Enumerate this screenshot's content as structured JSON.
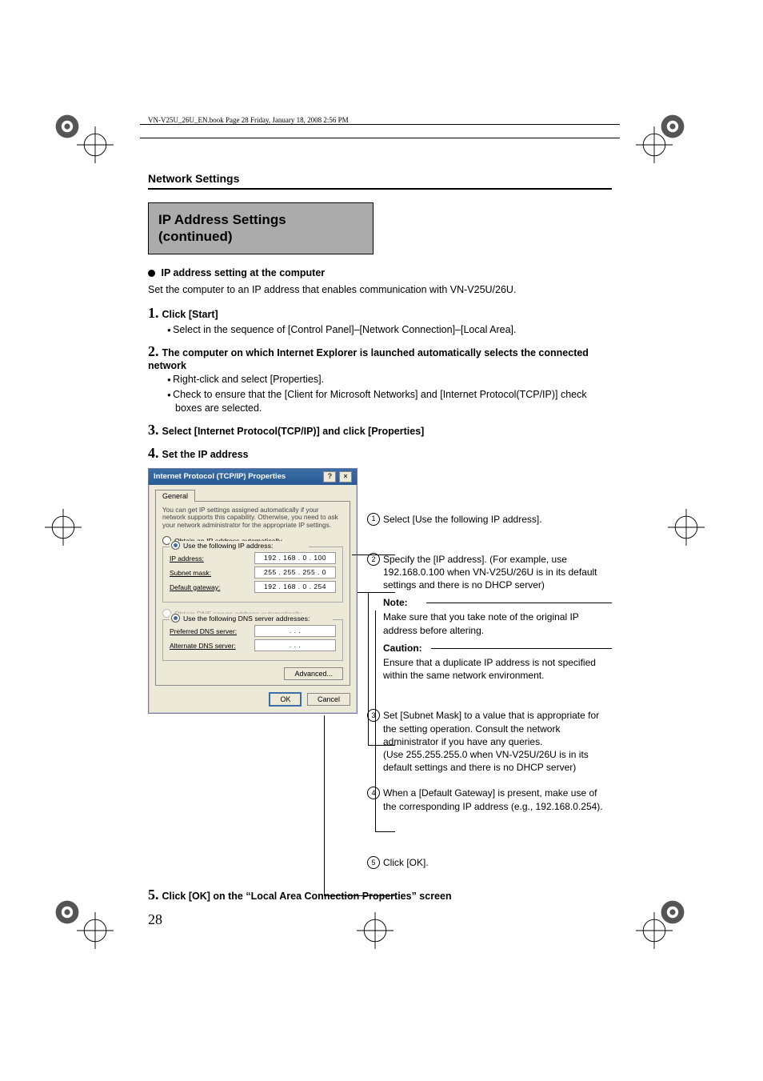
{
  "header_line": "VN-V25U_26U_EN.book  Page 28  Friday, January 18, 2008  2:56 PM",
  "section_title": "Network Settings",
  "gray_box_line1": "IP Address Settings",
  "gray_box_line2": "(continued)",
  "bullet_heading": "IP address setting at the computer",
  "intro_text": "Set the computer to an IP address that enables communication with VN-V25U/26U.",
  "steps": {
    "s1": {
      "label": "Click [Start]",
      "b1": "Select in the sequence of [Control Panel]–[Network Connection]–[Local Area]."
    },
    "s2": {
      "label": "The computer on which Internet Explorer is launched automatically selects the connected network",
      "b1": "Right-click and select [Properties].",
      "b2": "Check to ensure that the [Client for Microsoft Networks] and [Internet Protocol(TCP/IP)] check boxes are selected."
    },
    "s3": {
      "label": "Select [Internet Protocol(TCP/IP)] and click [Properties]"
    },
    "s4": {
      "label": "Set the IP address"
    },
    "s5": {
      "label": "Click [OK] on the “Local Area Connection Properties” screen"
    }
  },
  "dialog": {
    "title": "Internet Protocol (TCP/IP) Properties",
    "tab": "General",
    "desc": "You can get IP settings assigned automatically if your network supports this capability. Otherwise, you need to ask your network administrator for the appropriate IP settings.",
    "radio_auto_ip": "Obtain an IP address automatically",
    "radio_use_ip": "Use the following IP address:",
    "ip_label": "IP address:",
    "ip_value": "192 . 168 .   0 . 100",
    "subnet_label": "Subnet mask:",
    "subnet_value": "255 . 255 . 255 .   0",
    "gateway_label": "Default gateway:",
    "gateway_value": "192 . 168 .   0 . 254",
    "radio_auto_dns": "Obtain DNS server address automatically",
    "radio_use_dns": "Use the following DNS server addresses:",
    "pref_dns_label": "Preferred DNS server:",
    "pref_dns_value": ".       .       .",
    "alt_dns_label": "Alternate DNS server:",
    "alt_dns_value": ".       .       .",
    "advanced_btn": "Advanced...",
    "ok_btn": "OK",
    "cancel_btn": "Cancel"
  },
  "callouts": {
    "c1": "Select [Use the following IP address].",
    "c2": "Specify the [IP address]. (For example, use 192.168.0.100 when  VN-V25U/26U is in its default settings and there is no DHCP server)",
    "note_label": "Note:",
    "note_text": "Make sure that you take note of the original IP address before altering.",
    "caution_label": "Caution:",
    "caution_text": "Ensure that a duplicate IP address is not specified within the same network environment.",
    "c3": "Set [Subnet Mask] to a value that is appropriate for the setting operation. Consult the network administrator if you have any queries.\n(Use 255.255.255.0 when VN-V25U/26U is in its default settings and there is no DHCP server)",
    "c4": "When a [Default Gateway] is present, make use of the corresponding IP address (e.g., 192.168.0.254).",
    "c5": "Click [OK]."
  },
  "page_number": "28"
}
